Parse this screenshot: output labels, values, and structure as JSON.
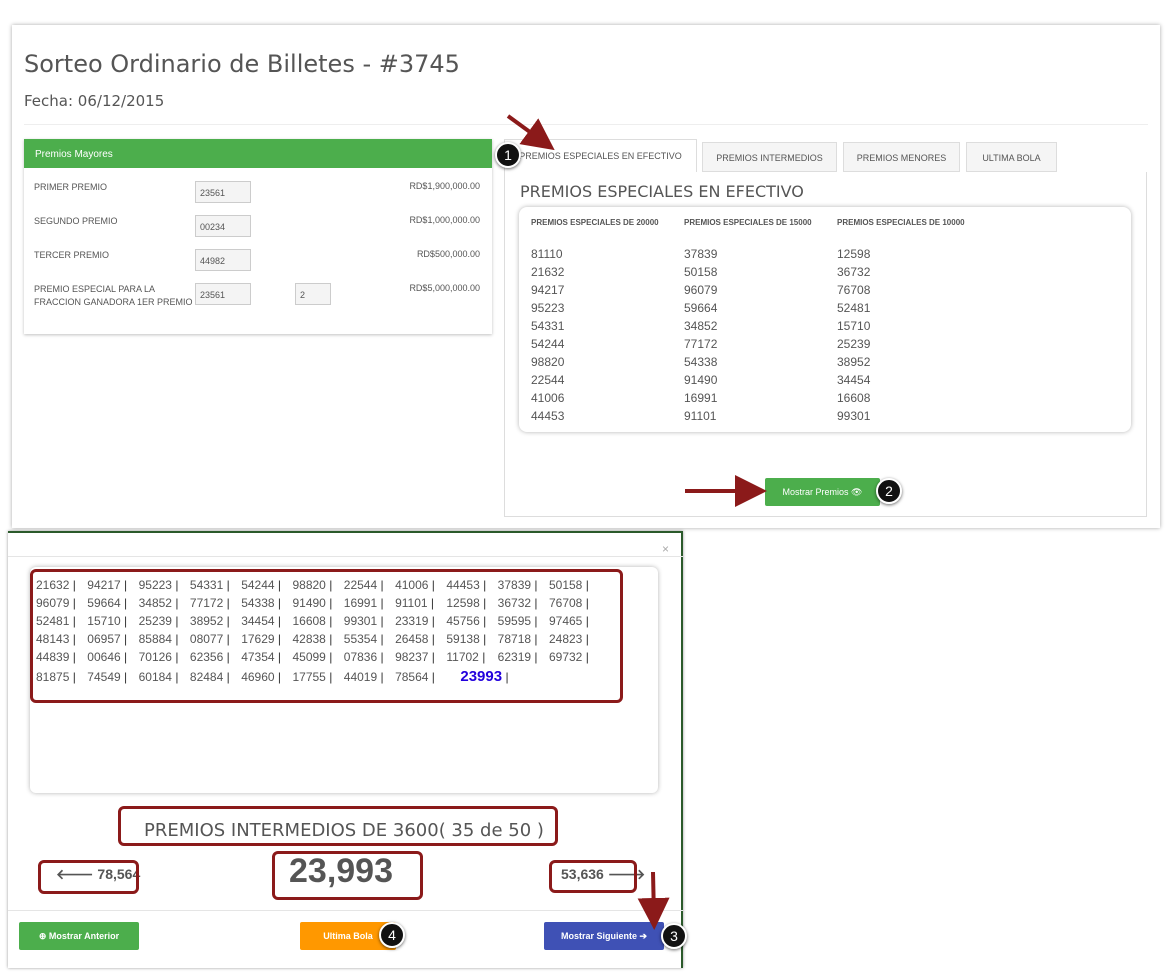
{
  "header": {
    "title": "Sorteo Ordinario de Billetes - #3745",
    "date": "Fecha: 06/12/2015"
  },
  "premios_mayores": {
    "heading": "Premios Mayores",
    "rows": [
      {
        "label": "PRIMER PREMIO",
        "value": "23561",
        "amount": "RD$1,900,000.00"
      },
      {
        "label": "SEGUNDO PREMIO",
        "value": "00234",
        "amount": "RD$1,000,000.00"
      },
      {
        "label": "TERCER PREMIO",
        "value": "44982",
        "amount": "RD$500,000.00"
      },
      {
        "label": "PREMIO ESPECIAL PARA LA FRACCION GANADORA 1ER PREMIO",
        "value": "23561",
        "extra": "2",
        "amount": "RD$5,000,000.00"
      }
    ]
  },
  "tabs": [
    {
      "label": "PREMIOS ESPECIALES EN EFECTIVO"
    },
    {
      "label": "PREMIOS INTERMEDIOS"
    },
    {
      "label": "PREMIOS MENORES"
    },
    {
      "label": "ULTIMA BOLA"
    }
  ],
  "especiales": {
    "heading": "PREMIOS ESPECIALES EN EFECTIVO",
    "columns": [
      {
        "header": "PREMIOS ESPECIALES DE 20000",
        "numbers": [
          "81110",
          "21632",
          "94217",
          "95223",
          "54331",
          "54244",
          "98820",
          "22544",
          "41006",
          "44453"
        ]
      },
      {
        "header": "PREMIOS ESPECIALES DE 15000",
        "numbers": [
          "37839",
          "50158",
          "96079",
          "59664",
          "34852",
          "77172",
          "54338",
          "91490",
          "16991",
          "91101"
        ]
      },
      {
        "header": "PREMIOS ESPECIALES DE 10000",
        "numbers": [
          "12598",
          "36732",
          "76708",
          "52481",
          "15710",
          "25239",
          "38952",
          "34454",
          "16608",
          "99301"
        ]
      }
    ]
  },
  "mostrar_premios": "Mostrar Premios 👁",
  "markers": {
    "m1": "1",
    "m2": "2",
    "m3": "3",
    "m4": "4"
  },
  "modal": {
    "close": "×",
    "rows": [
      [
        "21632",
        "94217",
        "95223",
        "54331",
        "54244",
        "98820",
        "22544",
        "41006",
        "44453",
        "37839",
        "50158"
      ],
      [
        "96079",
        "59664",
        "34852",
        "77172",
        "54338",
        "91490",
        "16991",
        "91101",
        "12598",
        "36732",
        "76708"
      ],
      [
        "52481",
        "15710",
        "25239",
        "38952",
        "34454",
        "16608",
        "99301",
        "23319",
        "45756",
        "59595",
        "97465"
      ],
      [
        "48143",
        "06957",
        "85884",
        "08077",
        "17629",
        "42838",
        "55354",
        "26458",
        "59138",
        "78718",
        "24823"
      ],
      [
        "44839",
        "00646",
        "70126",
        "62356",
        "47354",
        "45099",
        "07836",
        "98237",
        "11702",
        "62319",
        "69732"
      ],
      [
        "81875",
        "74549",
        "60184",
        "82484",
        "46960",
        "17755",
        "44019",
        "78564"
      ]
    ],
    "current_highlight": "23993",
    "title": "PREMIOS INTERMEDIOS DE 3600( 35 de 50 )",
    "prev": "🡐 78,564",
    "current": "23,993",
    "next": "53,636 🡒",
    "btn_prev": "⊕ Mostrar Anterior",
    "btn_last": "Ultima Bola",
    "btn_next": "Mostrar Siguiente ➔"
  },
  "colors": {
    "green": "#4cae4c",
    "orange": "#ff9800",
    "indigo": "#3f51b5",
    "highlight": "#8b1a1a",
    "current": "#2200dd"
  }
}
